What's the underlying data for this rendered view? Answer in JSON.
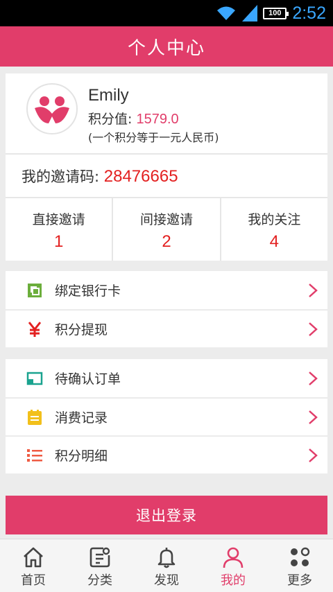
{
  "status_bar": {
    "time": "2:52",
    "battery_label": "100"
  },
  "header": {
    "title": "个人中心"
  },
  "profile": {
    "name": "Emily",
    "points_label": "积分值: ",
    "points_value": "1579.0",
    "points_note": "(一个积分等于一元人民币)",
    "invite_label": "我的邀请码: ",
    "invite_code": "28476665"
  },
  "stats": [
    {
      "label": "直接邀请",
      "value": "1"
    },
    {
      "label": "间接邀请",
      "value": "2"
    },
    {
      "label": "我的关注",
      "value": "4"
    }
  ],
  "menu_group1": [
    {
      "label": "绑定银行卡",
      "icon": "bank-card-icon"
    },
    {
      "label": "积分提现",
      "icon": "yuan-icon"
    }
  ],
  "menu_group2": [
    {
      "label": "待确认订单",
      "icon": "pending-order-icon"
    },
    {
      "label": "消费记录",
      "icon": "notepad-icon"
    },
    {
      "label": "积分明细",
      "icon": "list-icon"
    }
  ],
  "logout": {
    "label": "退出登录"
  },
  "tabbar": {
    "active": "我的",
    "items": [
      {
        "label": "首页",
        "icon": "home-icon"
      },
      {
        "label": "分类",
        "icon": "category-icon"
      },
      {
        "label": "发现",
        "icon": "bell-icon"
      },
      {
        "label": "我的",
        "icon": "user-icon"
      },
      {
        "label": "更多",
        "icon": "more-icon"
      }
    ]
  },
  "colors": {
    "brand": "#e13d6a",
    "highlight_red": "#e32020",
    "teal": "#1aa38f",
    "yellow": "#f2c01b",
    "orange_red": "#ef5b43"
  }
}
